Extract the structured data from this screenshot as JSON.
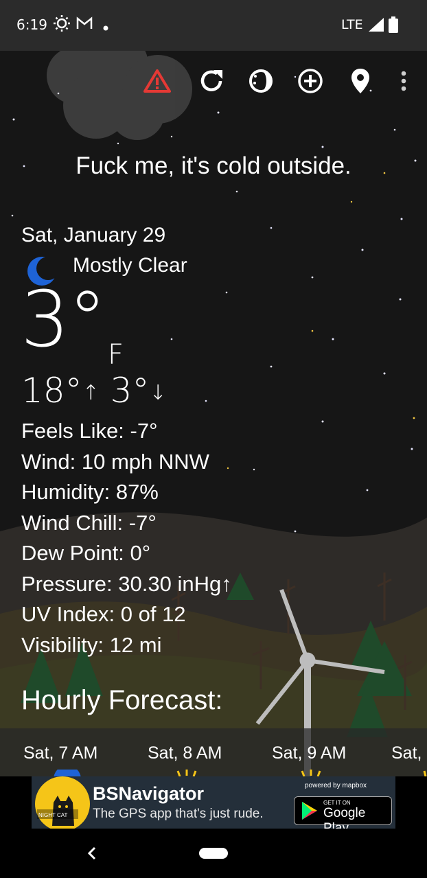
{
  "status_bar": {
    "time": "6:19",
    "network": "LTE",
    "icons": [
      "brightness-icon",
      "gmail-icon",
      "dot-icon",
      "signal-icon",
      "battery-icon"
    ]
  },
  "toolbar": {
    "icons": [
      "alert-icon",
      "refresh-icon",
      "theme-icon",
      "add-location-icon",
      "location-pin-icon",
      "more-vert-icon"
    ],
    "alert_color": "#e53935"
  },
  "quote": "Fuck me, it's cold outside.",
  "current": {
    "date": "Sat, January 29",
    "condition": "Mostly Clear",
    "condition_icon": "moon-icon",
    "temperature": "3°",
    "unit": "F",
    "high": "18°",
    "low": "3°",
    "high_arrow": "↑",
    "low_arrow": "↓"
  },
  "details": [
    {
      "label": "Feels Like:",
      "value": "-7°"
    },
    {
      "label": "Wind:",
      "value": "10 mph NNW"
    },
    {
      "label": "Humidity:",
      "value": "87%"
    },
    {
      "label": "Wind Chill:",
      "value": "-7°"
    },
    {
      "label": "Dew Point:",
      "value": "0°"
    },
    {
      "label": "Pressure:",
      "value": "30.30 inHg↑"
    },
    {
      "label": "UV Index:",
      "value": "0 of 12"
    },
    {
      "label": "Visibility:",
      "value": "12 mi"
    }
  ],
  "hourly": {
    "title": "Hourly Forecast:",
    "hours": [
      "Sat, 7 AM",
      "Sat, 8 AM",
      "Sat, 9 AM",
      "Sat,"
    ]
  },
  "ad": {
    "title": "BSNavigator",
    "subtitle": "The GPS app that's just rude.",
    "logo_text": "NIGHT CAT",
    "powered_by": "powered by mapbox",
    "store_small": "GET IT ON",
    "store_big": "Google Play",
    "accent": "#f5c518"
  },
  "nav": {
    "back_icon": "back-icon",
    "home_icon": "home-pill-icon"
  }
}
